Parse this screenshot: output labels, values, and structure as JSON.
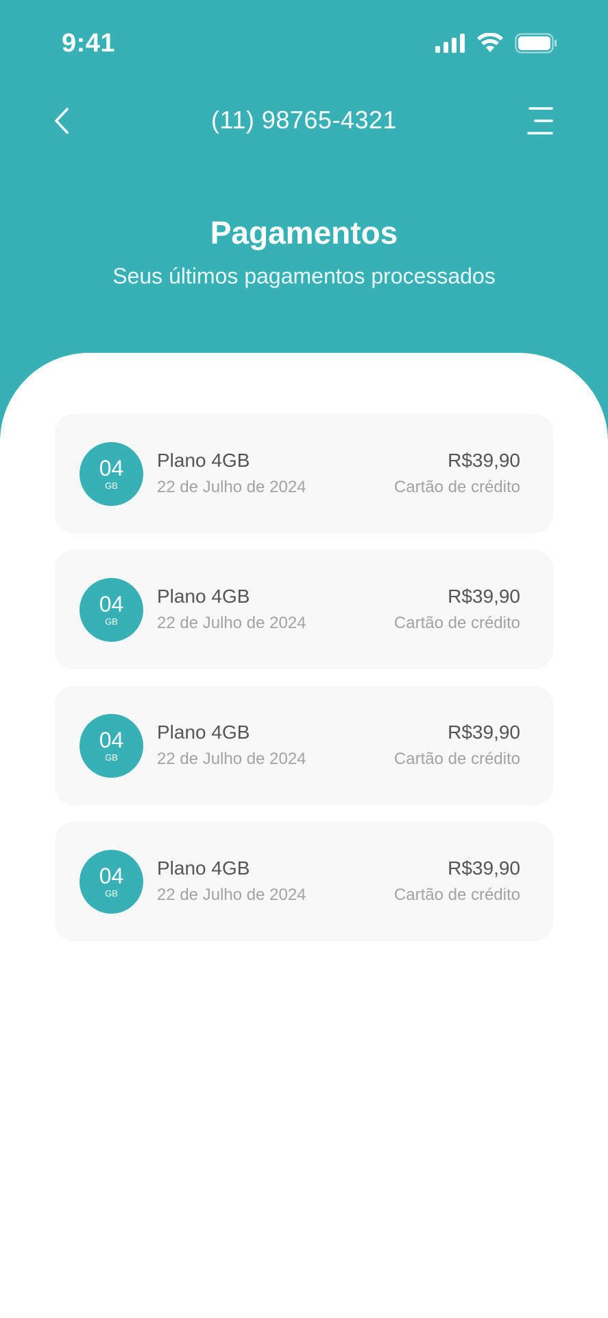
{
  "status_bar": {
    "time": "9:41"
  },
  "nav": {
    "phone": "(11) 98765-4321"
  },
  "header": {
    "title": "Pagamentos",
    "subtitle": "Seus últimos pagamentos processados"
  },
  "colors": {
    "accent": "#37b0b6",
    "card_bg": "#f8f8f8",
    "text_primary": "#555555",
    "text_secondary": "#a3a3a3"
  },
  "payments": [
    {
      "badge_num": "04",
      "badge_unit": "GB",
      "plan": "Plano 4GB",
      "date": "22 de Julho de 2024",
      "amount": "R$39,90",
      "method": "Cartão de crédito"
    },
    {
      "badge_num": "04",
      "badge_unit": "GB",
      "plan": "Plano 4GB",
      "date": "22 de Julho de 2024",
      "amount": "R$39,90",
      "method": "Cartão de crédito"
    },
    {
      "badge_num": "04",
      "badge_unit": "GB",
      "plan": "Plano 4GB",
      "date": "22 de Julho de 2024",
      "amount": "R$39,90",
      "method": "Cartão de crédito"
    },
    {
      "badge_num": "04",
      "badge_unit": "GB",
      "plan": "Plano 4GB",
      "date": "22 de Julho de 2024",
      "amount": "R$39,90",
      "method": "Cartão de crédito"
    }
  ]
}
